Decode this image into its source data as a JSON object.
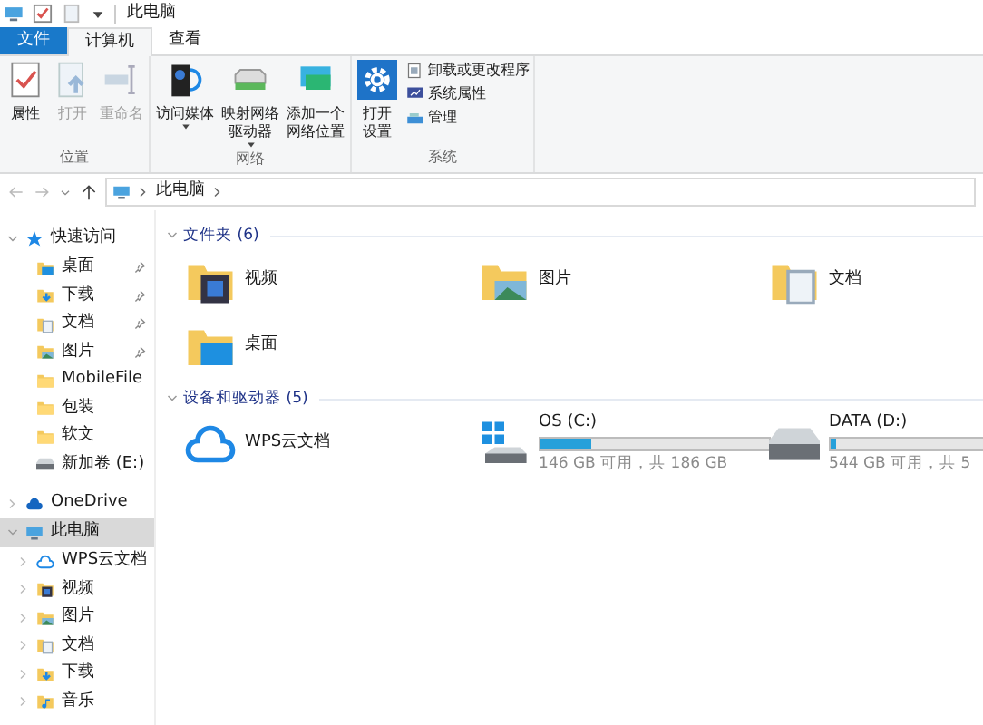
{
  "window": {
    "title": "此电脑"
  },
  "tabs": [
    {
      "label": "文件",
      "kind": "file",
      "selected": false
    },
    {
      "label": "计算机",
      "kind": "tab",
      "selected": true
    },
    {
      "label": "查看",
      "kind": "tab",
      "selected": false
    }
  ],
  "ribbon": {
    "groups": [
      {
        "label": "位置",
        "buttons": [
          {
            "label": [
              "属性"
            ],
            "kind": "properties",
            "disabled": false
          },
          {
            "label": [
              "打开"
            ],
            "kind": "open",
            "disabled": true
          },
          {
            "label": [
              "重命名"
            ],
            "kind": "rename",
            "disabled": true
          }
        ]
      },
      {
        "label": "网络",
        "buttons": [
          {
            "label": [
              "访问媒体"
            ],
            "kind": "media",
            "disabled": false,
            "dropdown": true
          },
          {
            "label": [
              "映射网络",
              "驱动器"
            ],
            "kind": "map",
            "disabled": false,
            "dropdown": true
          },
          {
            "label": [
              "添加一个",
              "网络位置"
            ],
            "kind": "netloc",
            "disabled": false,
            "dropdown": false
          }
        ]
      },
      {
        "label": "系统",
        "buttons": [
          {
            "label": [
              "打开",
              "设置"
            ],
            "kind": "settings",
            "disabled": false,
            "dropdown": false
          }
        ],
        "small_buttons": [
          {
            "label": "卸载或更改程序",
            "kind": "uninstall"
          },
          {
            "label": "系统属性",
            "kind": "sysprops"
          },
          {
            "label": "管理",
            "kind": "manage"
          }
        ]
      }
    ]
  },
  "address_bar": {
    "path": [
      "此电脑"
    ]
  },
  "sidebar": {
    "items": [
      {
        "label": "快速访问",
        "kind": "star",
        "expanded": true,
        "selected": false,
        "children": [
          {
            "label": "桌面",
            "kind": "desktop",
            "pinned": true
          },
          {
            "label": "下载",
            "kind": "download",
            "pinned": true
          },
          {
            "label": "文档",
            "kind": "doc",
            "pinned": true
          },
          {
            "label": "图片",
            "kind": "pictures",
            "pinned": true
          },
          {
            "label": "MobileFile",
            "kind": "folder",
            "pinned": false
          },
          {
            "label": "包装",
            "kind": "folder",
            "pinned": false
          },
          {
            "label": "软文",
            "kind": "folder",
            "pinned": false
          },
          {
            "label": "新加卷 (E:)",
            "kind": "drive",
            "pinned": false
          }
        ]
      },
      {
        "label": "OneDrive",
        "kind": "cloud",
        "expanded": false,
        "selected": false
      },
      {
        "label": "此电脑",
        "kind": "pc",
        "expanded": true,
        "selected": true,
        "children": [
          {
            "label": "WPS云文档",
            "kind": "wps",
            "pinned": false
          },
          {
            "label": "视频",
            "kind": "video",
            "pinned": false
          },
          {
            "label": "图片",
            "kind": "pictures",
            "pinned": false
          },
          {
            "label": "文档",
            "kind": "doc",
            "pinned": false
          },
          {
            "label": "下载",
            "kind": "download",
            "pinned": false
          },
          {
            "label": "音乐",
            "kind": "music",
            "pinned": false
          }
        ]
      }
    ]
  },
  "content": {
    "groups": [
      {
        "title": "文件夹 (6)",
        "expanded": true,
        "items": [
          {
            "label": "视频",
            "kind": "video"
          },
          {
            "label": "图片",
            "kind": "pictures"
          },
          {
            "label": "文档",
            "kind": "doc"
          },
          {
            "label": "桌面",
            "kind": "desktop"
          }
        ]
      },
      {
        "title": "设备和驱动器 (5)",
        "expanded": true,
        "items": [
          {
            "label": "WPS云文档",
            "kind": "wps"
          },
          {
            "label": "OS (C:)",
            "kind": "system-drive",
            "level": 0.22,
            "detail": "146 GB 可用，共 186 GB"
          },
          {
            "label": "DATA (D:)",
            "kind": "drive",
            "level": 0.02,
            "detail": "544 GB 可用，共 5"
          }
        ]
      }
    ]
  }
}
